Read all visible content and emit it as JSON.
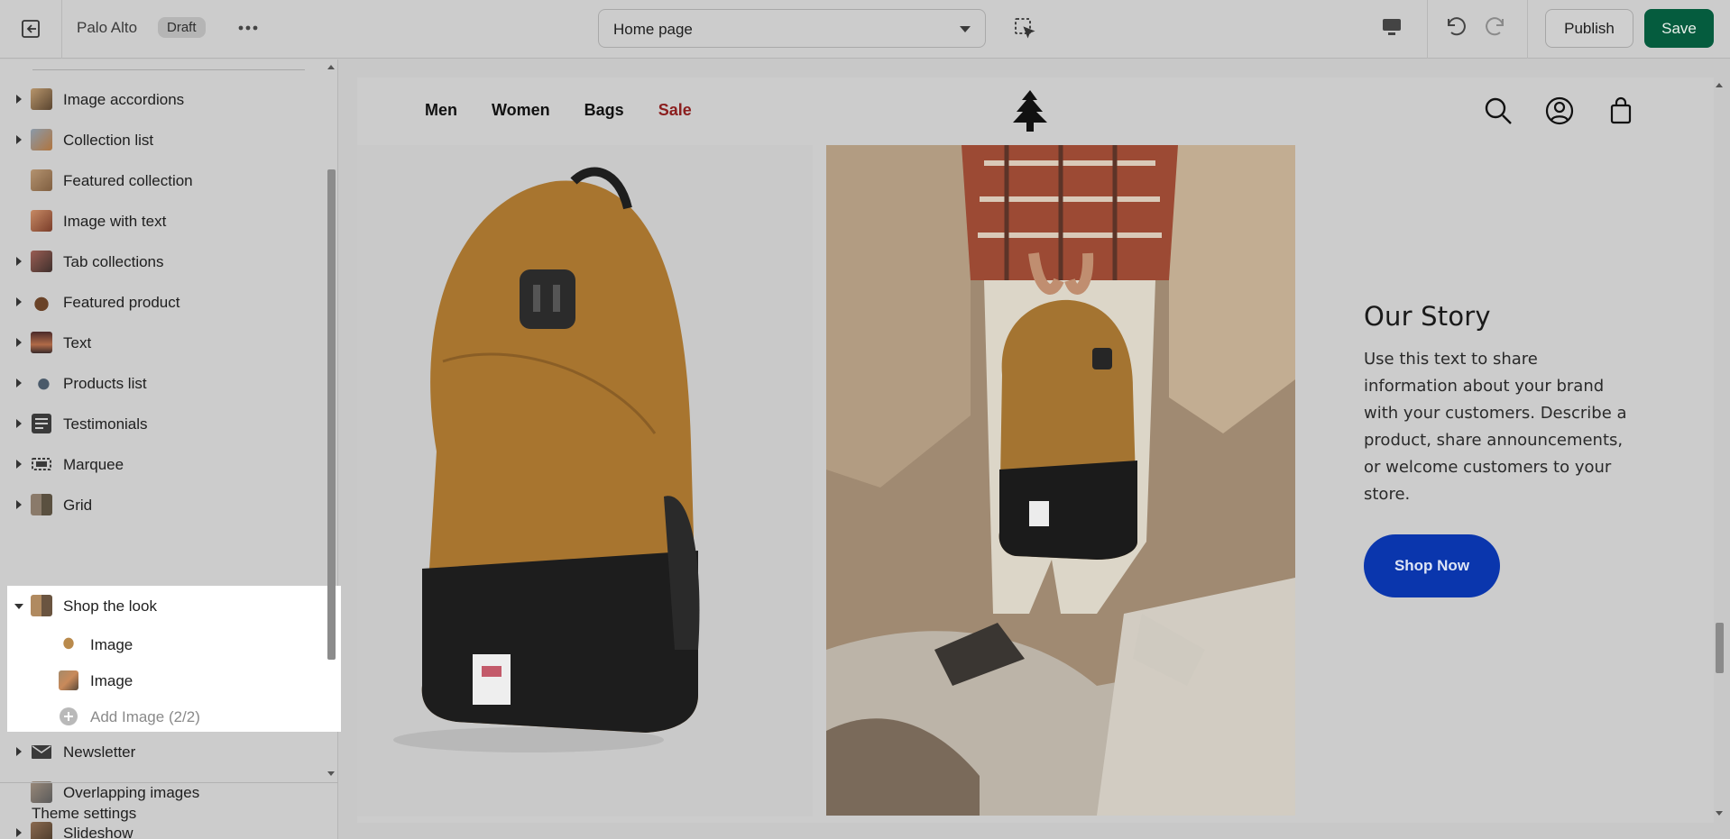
{
  "topbar": {
    "store_name": "Palo Alto",
    "status_badge": "Draft",
    "page_select": "Home page",
    "publish_label": "Publish",
    "save_label": "Save",
    "icons": [
      "exit-icon",
      "more-icon",
      "inspector-icon",
      "desktop-icon",
      "undo-icon",
      "redo-icon"
    ]
  },
  "sidebar": {
    "items": [
      {
        "label": "Image accordions",
        "expandable": true,
        "thumb_color": "#8a6a4a"
      },
      {
        "label": "Collection list",
        "expandable": true,
        "thumb_color": "#6c7b8a"
      },
      {
        "label": "Featured collection",
        "expandable": false,
        "thumb_color": "#9a7c58"
      },
      {
        "label": "Image with text",
        "expandable": false,
        "thumb_color": "#a2664a"
      },
      {
        "label": "Tab collections",
        "expandable": true,
        "thumb_color": "#7a5b4c"
      },
      {
        "label": "Featured product",
        "expandable": true,
        "thumb_color": "#6a4a30"
      },
      {
        "label": "Text",
        "expandable": true,
        "thumb_color": "#6e4232"
      },
      {
        "label": "Products list",
        "expandable": true,
        "thumb_color": "#5a6a7a"
      },
      {
        "label": "Testimonials",
        "expandable": true,
        "thumb_color": "#3a3a3a"
      },
      {
        "label": "Marquee",
        "expandable": true,
        "thumb_color": "#5a5a5a"
      },
      {
        "label": "Grid",
        "expandable": true,
        "thumb_color": "#7a6a5a"
      }
    ],
    "selected_section": {
      "label": "Shop the look",
      "blocks": [
        {
          "label": "Image"
        },
        {
          "label": "Image"
        }
      ],
      "add_label": "Add Image (2/2)"
    },
    "items_after": [
      {
        "label": "Newsletter",
        "expandable": true
      },
      {
        "label": "Overlapping images",
        "expandable": false
      },
      {
        "label": "Slideshow",
        "expandable": true
      }
    ],
    "footer_label": "Theme settings"
  },
  "preview": {
    "nav": [
      "Men",
      "Women",
      "Bags"
    ],
    "nav_sale": "Sale",
    "story_title": "Our Story",
    "story_text": "Use this text to share information about your brand with your customers. Describe a product, share announcements, or welcome customers to your store.",
    "button_label": "Shop Now"
  },
  "colors": {
    "save": "#055c3e",
    "shop_now": "#0a36ad",
    "sale": "#8b1e1e"
  }
}
